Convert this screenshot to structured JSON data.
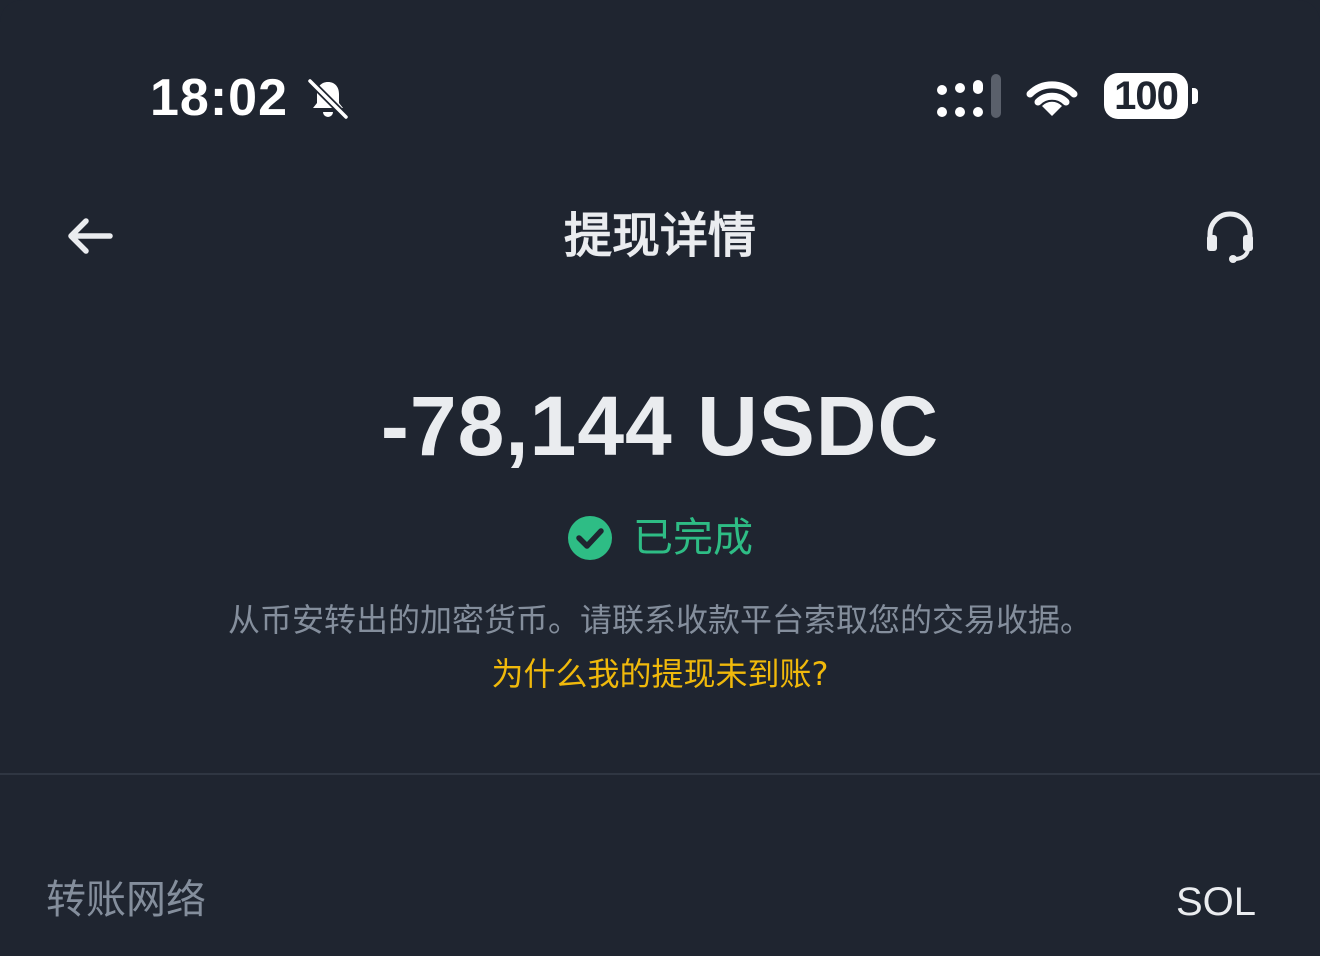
{
  "status_bar": {
    "time": "18:02",
    "battery": "100",
    "icons": [
      "bell-muted-icon",
      "signal-icon",
      "wifi-icon",
      "battery-icon"
    ]
  },
  "header": {
    "title": "提现详情",
    "back_icon": "arrow-left-icon",
    "support_icon": "headset-icon"
  },
  "summary": {
    "amount": "-78,144 USDC",
    "status": "已完成",
    "status_icon": "check-circle-icon",
    "description": "从币安转出的加密货币。请联系收款平台索取您的交易收据。",
    "help_link": "为什么我的提现未到账?"
  },
  "details": [
    {
      "label": "转账网络",
      "value": "SOL"
    }
  ],
  "colors": {
    "background": "#1f2530",
    "text_primary": "#eaecef",
    "text_secondary": "#848e9c",
    "success": "#2ebd85",
    "link": "#f0b90b"
  }
}
